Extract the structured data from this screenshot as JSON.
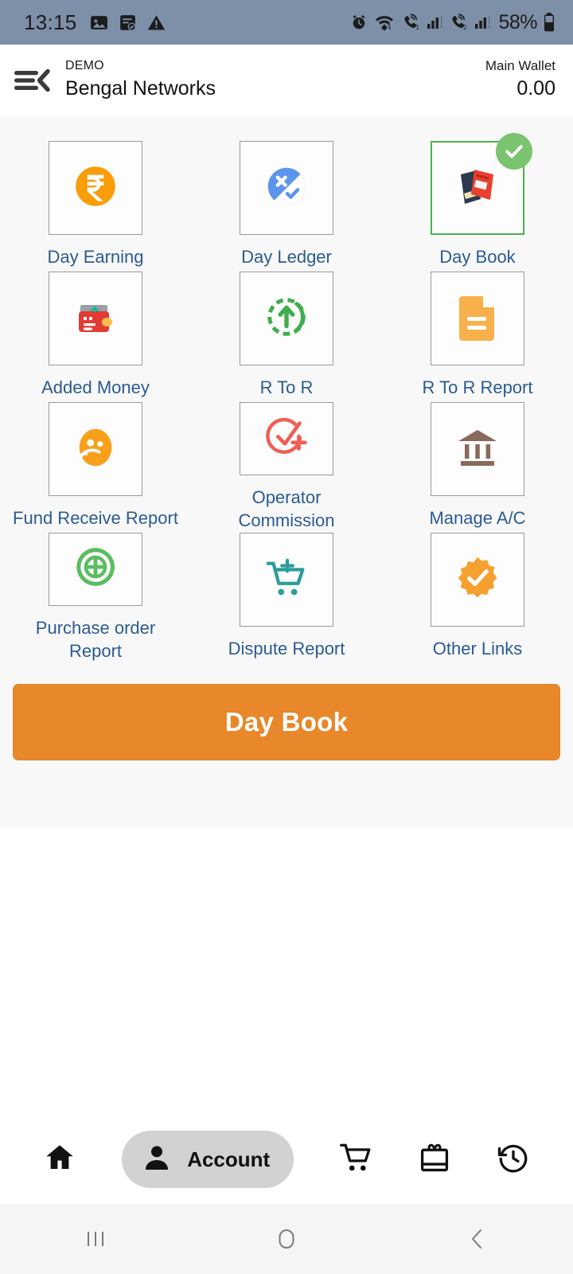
{
  "status_bar": {
    "time": "13:15",
    "battery_text": "58%",
    "left_icons": [
      "image-icon",
      "note-checked-icon",
      "warning-icon"
    ],
    "right_icons": [
      "alarm-icon",
      "wifi-icon",
      "call-sim1-icon",
      "signal-sim1-icon",
      "call-sim2-icon",
      "signal-sim2-icon",
      "battery-icon"
    ],
    "background": "#7e90a8"
  },
  "header": {
    "menu_icon": "hamburger-back-icon",
    "subtitle": "DEMO",
    "title": "Bengal Networks",
    "wallet_label": "Main Wallet",
    "wallet_amount": "0.00"
  },
  "grid": {
    "items": [
      {
        "label": "Day Earning",
        "icon": "rupee-coin-icon",
        "selected": false
      },
      {
        "label": "Day Ledger",
        "icon": "ledger-check-cross-icon",
        "selected": false
      },
      {
        "label": "Day Book",
        "icon": "books-stack-icon",
        "selected": true
      },
      {
        "label": "Added Money",
        "icon": "wallet-money-icon",
        "selected": false
      },
      {
        "label": "R To R",
        "icon": "upload-circle-icon",
        "selected": false
      },
      {
        "label": "R To R Report",
        "icon": "document-icon",
        "selected": false
      },
      {
        "label": "Fund Receive Report",
        "icon": "user-fund-icon",
        "selected": false
      },
      {
        "label": "Operator Commission",
        "icon": "check-plus-icon",
        "selected": false
      },
      {
        "label": "Manage A/C",
        "icon": "bank-icon",
        "selected": false
      },
      {
        "label": "Purchase order Report",
        "icon": "plus-circle-icon",
        "selected": false
      },
      {
        "label": "Dispute Report",
        "icon": "cart-plus-icon",
        "selected": false
      },
      {
        "label": "Other Links",
        "icon": "verified-badge-icon",
        "selected": false
      }
    ],
    "selected_badge": "check-icon",
    "label_color": "#2b5b92",
    "selected_border_color": "#4caf50"
  },
  "primary_button": {
    "label": "Day Book",
    "background": "#e8882a",
    "text_color": "#ffffff"
  },
  "bottom_nav": {
    "items": [
      {
        "name": "home",
        "icon": "home-icon",
        "label": "",
        "active": false
      },
      {
        "name": "account",
        "icon": "person-icon",
        "label": "Account",
        "active": true
      },
      {
        "name": "cart",
        "icon": "cart-icon",
        "label": "",
        "active": false
      },
      {
        "name": "offers",
        "icon": "gift-icon",
        "label": "",
        "active": false
      },
      {
        "name": "history",
        "icon": "history-icon",
        "label": "",
        "active": false
      }
    ],
    "active_pill_color": "#d2d2d2"
  },
  "android_nav": {
    "recents": "recents-icon",
    "home": "home-circle-icon",
    "back": "back-chevron-icon"
  }
}
